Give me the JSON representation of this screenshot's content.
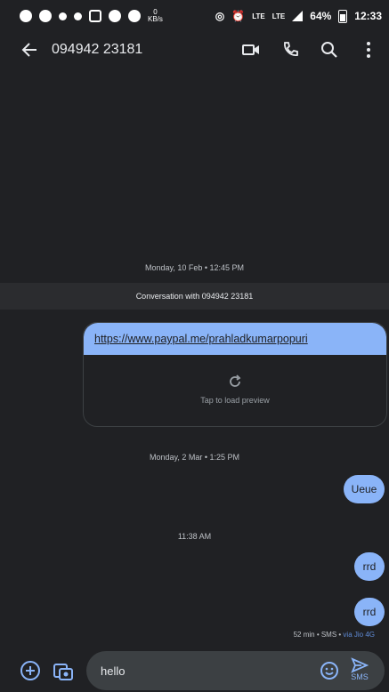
{
  "status_bar": {
    "data_speed_value": "0",
    "data_speed_unit": "KB/s",
    "lte1": "LTE",
    "lte2": "LTE",
    "battery": "64%",
    "time": "12:33"
  },
  "app_bar": {
    "title": "094942 23181"
  },
  "conversation": {
    "timestamp1": "Monday, 10 Feb • 12:45 PM",
    "banner": "Conversation with 094942 23181",
    "link_url": "https://www.paypal.me/prahladkumarpopuri",
    "link_preview_text": "Tap to load preview",
    "timestamp2": "Monday, 2 Mar • 1:25 PM",
    "msg1": "Ueue",
    "timestamp3": "11:38 AM",
    "msg2": "rrd",
    "msg3": "rrd",
    "meta_text": "52 min • SMS • ",
    "meta_via": "via Jio 4G"
  },
  "composer": {
    "value": "hello",
    "send_label": "SMS"
  },
  "colors": {
    "background": "#202124",
    "bubble": "#8ab4f8",
    "input": "#3c4043"
  }
}
